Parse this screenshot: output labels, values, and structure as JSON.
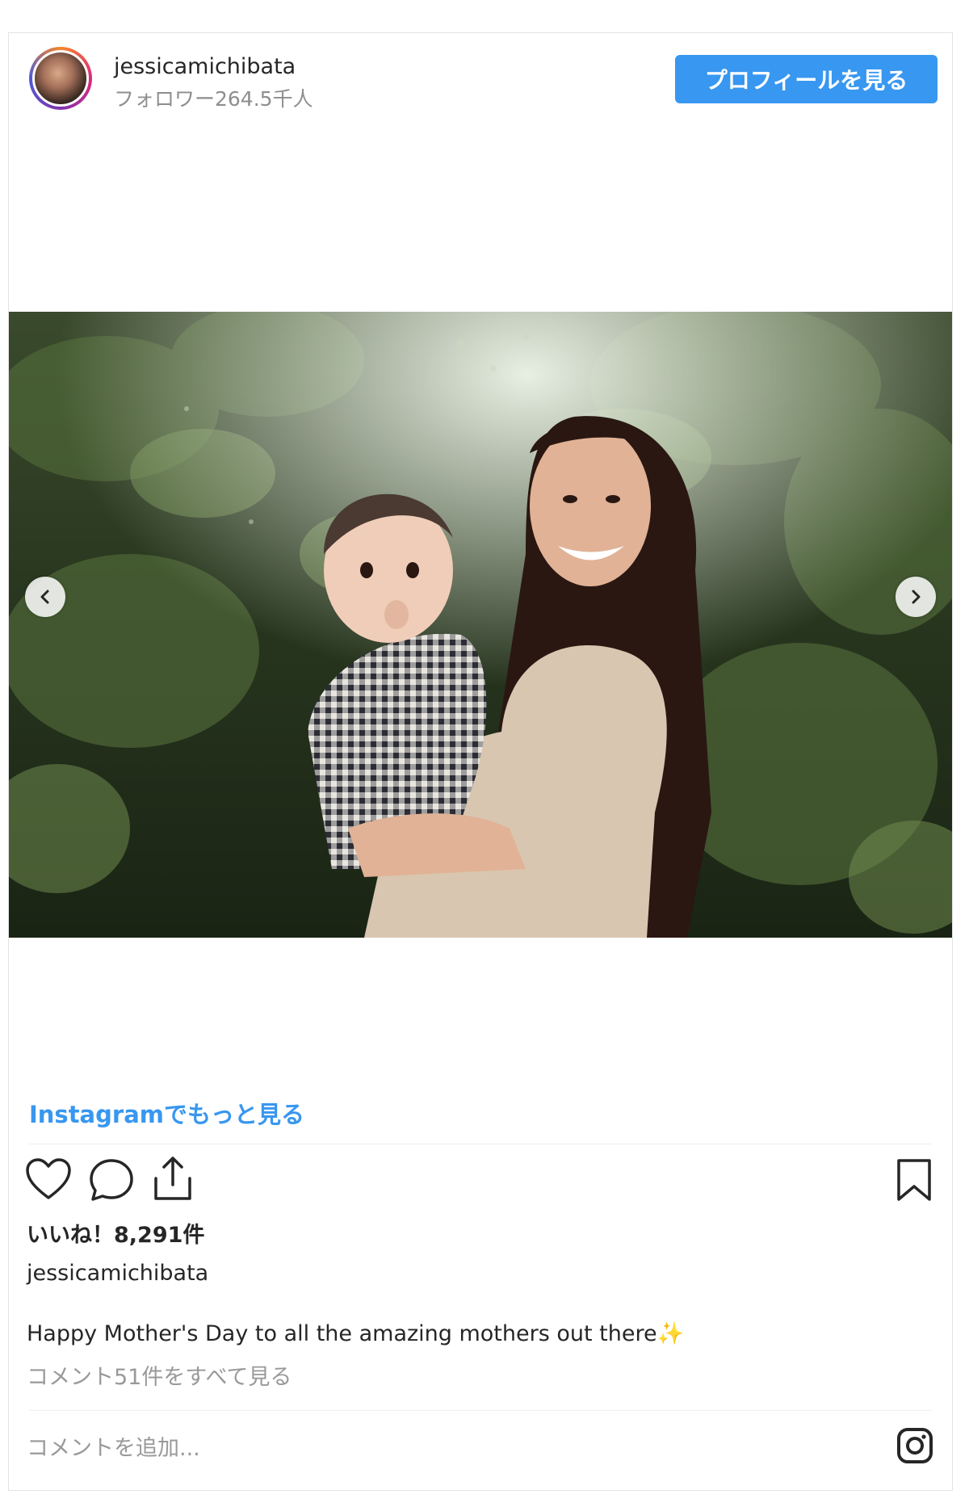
{
  "header": {
    "username": "jessicamichibata",
    "followers": "フォロワー264.5千人",
    "profile_button": "プロフィールを見る"
  },
  "post": {
    "more_link": "Instagramでもっと見る",
    "likes": "いいね！8,291件",
    "caption_user": "jessicamichibata",
    "caption_text": "Happy Mother's Day to all the amazing mothers out there✨",
    "comments_link": "コメント51件をすべて見る",
    "comment_placeholder": "コメントを追加..."
  },
  "icons": {
    "carousel_prev": "chevron-left-icon",
    "carousel_next": "chevron-right-icon",
    "like": "heart-icon",
    "comment": "comment-bubble-icon",
    "share": "share-icon",
    "save": "bookmark-icon",
    "instagram": "instagram-logo-icon"
  },
  "colors": {
    "accent": "#3897f0",
    "muted_text": "#999999",
    "text": "#262626"
  }
}
